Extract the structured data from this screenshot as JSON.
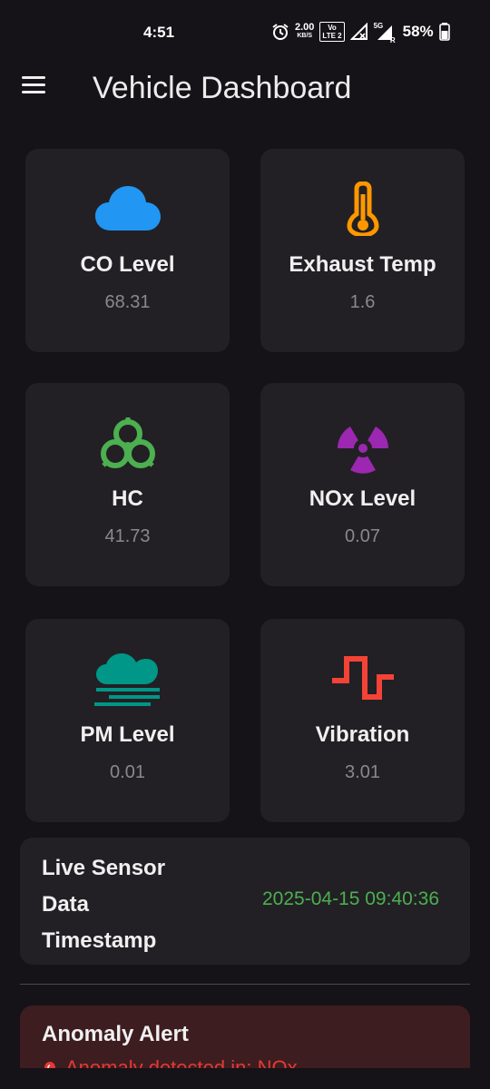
{
  "status_bar": {
    "time": "4:51",
    "data_rate_top": "2.00",
    "data_rate_bottom": "KB/S",
    "volte_top": "Vo",
    "volte_bottom": "LTE 2",
    "network": "5G",
    "network_sub": "R",
    "battery": "58%"
  },
  "app_bar": {
    "title": "Vehicle Dashboard",
    "menu_icon": "hamburger-menu-icon"
  },
  "cards": [
    {
      "label": "CO Level",
      "value": "68.31",
      "icon": "cloud-icon",
      "color": "#2196f3"
    },
    {
      "label": "Exhaust Temp",
      "value": "1.6",
      "icon": "thermometer-icon",
      "color": "#ff9800"
    },
    {
      "label": "HC",
      "value": "41.73",
      "icon": "biohazard-icon",
      "color": "#4caf50"
    },
    {
      "label": "NOx Level",
      "value": "0.07",
      "icon": "radioactive-icon",
      "color": "#9c27b0"
    },
    {
      "label": "PM Level",
      "value": "0.01",
      "icon": "foggy-cloud-icon",
      "color": "#009688"
    },
    {
      "label": "Vibration",
      "value": "3.01",
      "icon": "vibration-wave-icon",
      "color": "#f44336"
    }
  ],
  "sensor": {
    "label_line1": "Live Sensor",
    "label_line2": "Data",
    "label_line3": "Timestamp",
    "timestamp": "2025-04-15 09:40:36",
    "timestamp_color": "#4caf50"
  },
  "alert": {
    "title": "Anomaly Alert",
    "message": "Anomaly detected in: NOx",
    "icon": "siren-icon",
    "color": "#e53935"
  }
}
